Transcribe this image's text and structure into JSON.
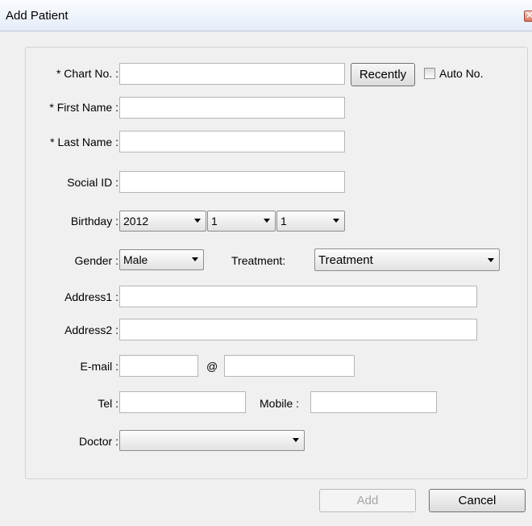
{
  "window": {
    "title": "Add Patient"
  },
  "form": {
    "chart_no": {
      "label": "* Chart No. :",
      "value": ""
    },
    "recently_label": "Recently",
    "auto_no": {
      "label": "Auto No.",
      "checked": false
    },
    "first_name": {
      "label": "* First Name :",
      "value": ""
    },
    "last_name": {
      "label": "* Last Name :",
      "value": ""
    },
    "social_id": {
      "label": "Social ID :",
      "value": ""
    },
    "birthday": {
      "label": "Birthday :",
      "year": "2012",
      "month": "1",
      "day": "1"
    },
    "gender": {
      "label": "Gender :",
      "value": "Male"
    },
    "treatment": {
      "label": "Treatment:",
      "value": "Treatment"
    },
    "address1": {
      "label": "Address1 :",
      "value": ""
    },
    "address2": {
      "label": "Address2 :",
      "value": ""
    },
    "email": {
      "label": "E-mail :",
      "at": "@",
      "user": "",
      "domain": ""
    },
    "tel": {
      "label": "Tel :",
      "value": ""
    },
    "mobile": {
      "label": "Mobile :",
      "value": ""
    },
    "doctor": {
      "label": "Doctor :",
      "value": ""
    }
  },
  "buttons": {
    "add": "Add",
    "cancel": "Cancel"
  }
}
